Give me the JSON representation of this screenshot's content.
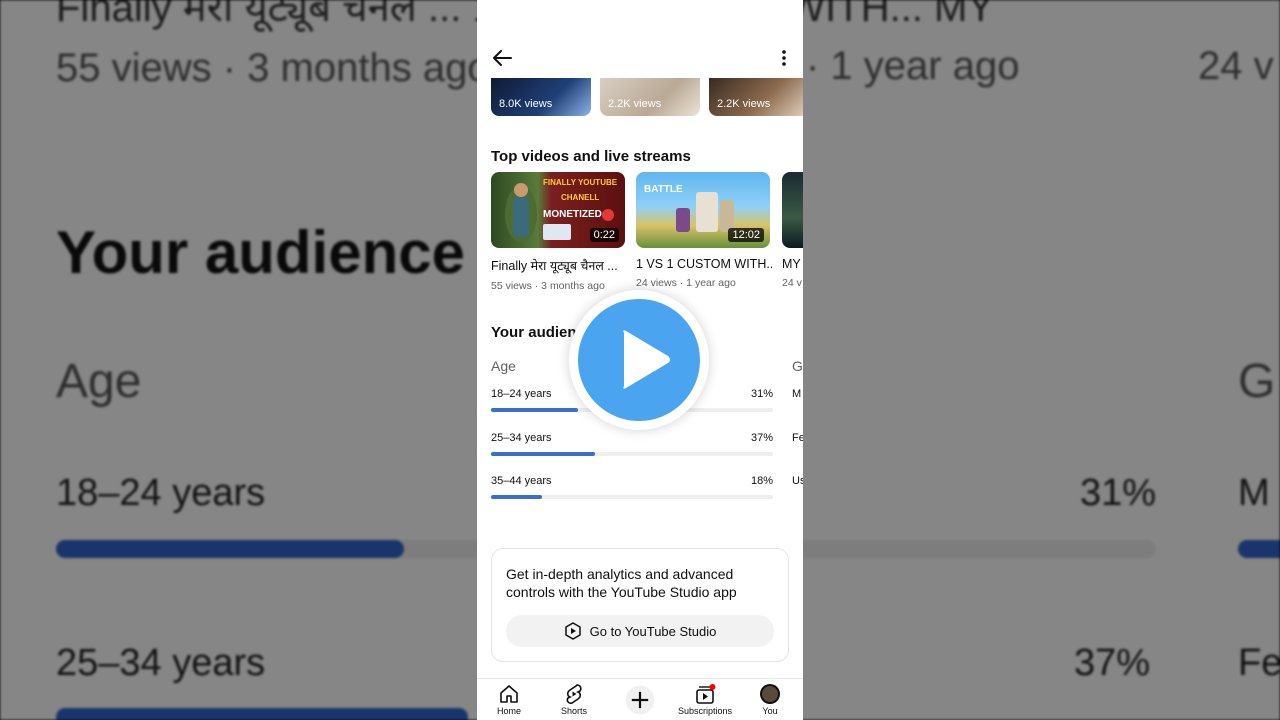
{
  "background": {
    "line1": "Finally मेरा यूट्यूब चैनल ... 1 VS 1 CUSTOM WITH... MY",
    "views_left": "55 views · 3 months ago",
    "views_mid": "· 1 year ago",
    "views_right": "24 v",
    "heading": "Your audience",
    "age": "Age",
    "gender_peek": "G",
    "row1_label": "18–24 years",
    "row1_pct": "31%",
    "row1_peek": "M",
    "row2_label": "25–34 years",
    "row2_pct": "37%",
    "row2_peek": "Fe"
  },
  "top_thumbs": [
    {
      "views": "8.0K views"
    },
    {
      "views": "2.2K views"
    },
    {
      "views": "2.2K views"
    }
  ],
  "top_videos": {
    "title": "Top videos and live streams",
    "items": [
      {
        "title": "Finally मेरा यूट्यूब चैनल ...",
        "meta": "55 views · 3 months ago",
        "duration": "0:22",
        "thumb_text": [
          "FINALLY YOUTUBE",
          "CHANELL",
          "MONETIZED"
        ]
      },
      {
        "title": "1 VS 1 CUSTOM WITH...",
        "meta": "24 views · 1 year ago",
        "duration": "12:02",
        "thumb_text": [
          "BATTLE"
        ]
      },
      {
        "title": "MY",
        "meta": "24 v",
        "duration": "",
        "thumb_text": []
      }
    ]
  },
  "audience": {
    "title": "Your audience",
    "age_label": "Age",
    "gender_label": "G",
    "rows": [
      {
        "label": "18–24 years",
        "pct": "31%",
        "value": 31,
        "gender_peek": "M"
      },
      {
        "label": "25–34 years",
        "pct": "37%",
        "value": 37,
        "gender_peek": "Fe"
      },
      {
        "label": "35–44 years",
        "pct": "18%",
        "value": 18,
        "gender_peek": "Us"
      }
    ]
  },
  "studio": {
    "text": "Get in-depth analytics and advanced controls with the YouTube Studio app",
    "button": "Go to YouTube Studio"
  },
  "nav": {
    "home": "Home",
    "shorts": "Shorts",
    "subscriptions": "Subscriptions",
    "you": "You"
  },
  "colors": {
    "accent_bar": "#3a6fd0",
    "play_button": "#4aa4ef",
    "notification_dot": "#ff0000"
  }
}
